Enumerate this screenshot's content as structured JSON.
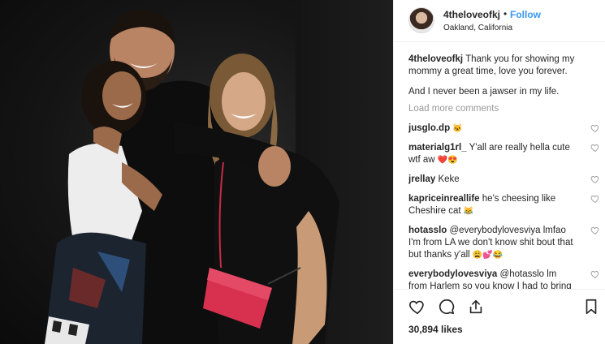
{
  "post": {
    "username": "4theloveofkj",
    "separator": "•",
    "follow_label": "Follow",
    "location": "Oakland, California",
    "caption_user": "4theloveofkj",
    "caption_text": "Thank you for showing my mommy a great time, love you forever.",
    "caption_text_2": "And I never been a jawser in my life.",
    "load_more": "Load more comments",
    "likes": "30,894 likes"
  },
  "comments": [
    {
      "user": "jusglo.dp",
      "text": "",
      "emoji": "🐱"
    },
    {
      "user": "materialg1rl_",
      "text": "Y'all are really hella cute wtf aw",
      "emoji": "❤️😍"
    },
    {
      "user": "jrellay",
      "text": "Keke",
      "emoji": ""
    },
    {
      "user": "kapriceinreallife",
      "text": "he's cheesing like Cheshire cat",
      "emoji": "😹"
    },
    {
      "user": "hotasslo",
      "text": "@everybodylovesviya lmfao I'm from LA we don't know shit bout that but thanks y'all",
      "emoji": "😩💕😂"
    },
    {
      "user": "everybodylovesviya",
      "text": "@hotasslo lm from Harlem so you know I had to bring out all the tools",
      "emoji": ""
    }
  ],
  "icons": {
    "heart": "heart-icon",
    "comment": "comment-icon",
    "share": "share-icon",
    "bookmark": "bookmark-icon"
  },
  "colors": {
    "link_blue": "#3897f0",
    "text": "#262626",
    "muted": "#999999",
    "bag_red": "#d8314f"
  }
}
